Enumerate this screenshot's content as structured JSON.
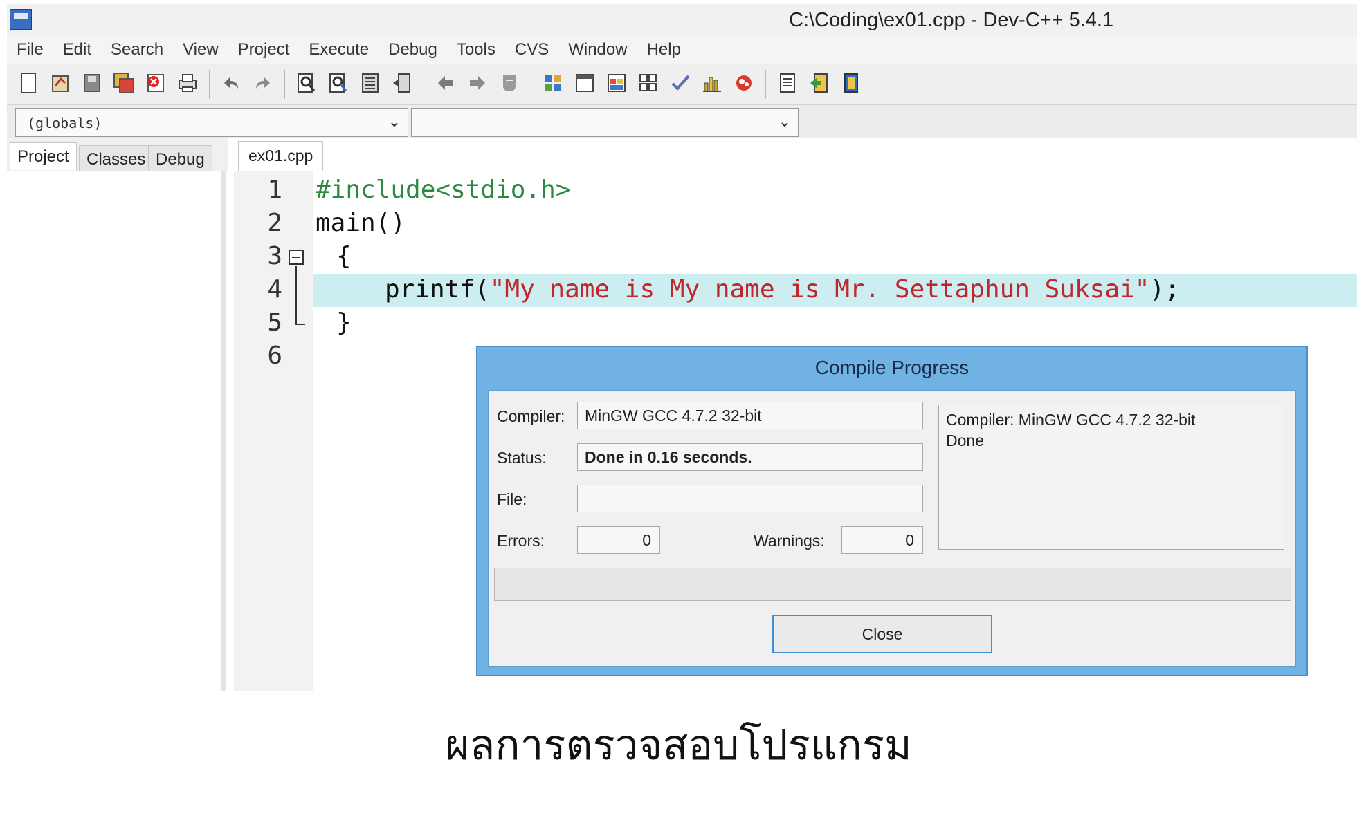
{
  "window": {
    "title": "C:\\Coding\\ex01.cpp - Dev-C++ 5.4.1",
    "app_icon": "devcpp-app-icon"
  },
  "menu": [
    "File",
    "Edit",
    "Search",
    "View",
    "Project",
    "Execute",
    "Debug",
    "Tools",
    "CVS",
    "Window",
    "Help"
  ],
  "toolbar": {
    "groups": [
      [
        "new-file-icon",
        "open-file-icon",
        "save-icon",
        "save-all-icon",
        "close-file-icon",
        "print-icon"
      ],
      [
        "undo-icon",
        "redo-icon"
      ],
      [
        "find-icon",
        "replace-icon",
        "indent-icon",
        "unindent-icon"
      ],
      [
        "back-icon",
        "forward-icon",
        "bookmark-icon"
      ],
      [
        "compile-icon",
        "run-icon",
        "compile-run-icon",
        "rebuild-icon",
        "syntax-check-icon",
        "profile-icon",
        "debug-icon"
      ],
      [
        "new-project-icon",
        "add-to-project-icon",
        "exit-icon"
      ]
    ]
  },
  "scope": {
    "class_value": "(globals)",
    "function_value": ""
  },
  "left_tabs": [
    "Project",
    "Classes",
    "Debug"
  ],
  "editor": {
    "tab": "ex01.cpp",
    "line_numbers": [
      "1",
      "2",
      "3",
      "4",
      "5",
      "6"
    ],
    "lines": {
      "l1": "#include<stdio.h>",
      "l2": "main()",
      "l3": "{",
      "l4_fn": "printf(",
      "l4_str": "\"My name is My name is Mr. Settaphun Suksai\"",
      "l4_end": ");",
      "l5": "}",
      "l6": ""
    }
  },
  "dialog": {
    "title": "Compile Progress",
    "compiler_label": "Compiler:",
    "compiler_value": "MinGW GCC 4.7.2 32-bit",
    "status_label": "Status:",
    "status_value": "Done in 0.16 seconds.",
    "file_label": "File:",
    "file_value": "",
    "errors_label": "Errors:",
    "errors_value": "0",
    "warnings_label": "Warnings:",
    "warnings_value": "0",
    "log": [
      "Compiler: MinGW GCC 4.7.2 32-bit",
      "Done"
    ],
    "close_label": "Close",
    "progress": 0
  },
  "caption": "ผลการตรวจสอบโปรแกรม",
  "colors": {
    "preprocessor": "#2b8a3e",
    "string": "#c0262b",
    "current_line": "#cdeef0",
    "dialog_frame": "#6fb2e3",
    "close_border": "#3c8ed8"
  }
}
